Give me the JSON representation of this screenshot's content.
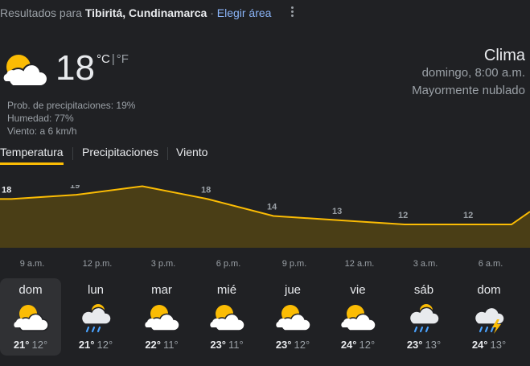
{
  "header": {
    "results_prefix": "Resultados para",
    "location": "Tibiritá, Cundinamarca",
    "separator": "·",
    "choose_area": "Elegir área"
  },
  "current": {
    "icon": "partly-cloudy-icon",
    "temperature": "18",
    "unit_c": "°C",
    "unit_sep": "|",
    "unit_f": "°F",
    "precip": "Prob. de precipitaciones: 19%",
    "humidity": "Humedad: 77%",
    "wind": "Viento: a 6 km/h",
    "title": "Clima",
    "time": "domingo, 8:00 a.m.",
    "condition": "Mayormente nublado"
  },
  "tabs": [
    {
      "label": "Temperatura",
      "active": true
    },
    {
      "label": "Precipitaciones",
      "active": false
    },
    {
      "label": "Viento",
      "active": false
    }
  ],
  "chart_data": {
    "type": "area",
    "x": [
      "9 a.m.",
      "12 p.m.",
      "3 p.m.",
      "6 p.m.",
      "9 p.m.",
      "12 a.m.",
      "3 a.m.",
      "6 a.m."
    ],
    "values": [
      18,
      19,
      21,
      18,
      14,
      13,
      12,
      12
    ],
    "ylim": [
      0,
      25
    ],
    "line_color": "#fbbc04",
    "fill_color": "#4a3e16"
  },
  "days": [
    {
      "name": "dom",
      "icon": "partly-cloudy-icon",
      "hi": "21°",
      "lo": "12°",
      "selected": true
    },
    {
      "name": "lun",
      "icon": "rain-partly-cloudy-icon",
      "hi": "21°",
      "lo": "12°",
      "selected": false
    },
    {
      "name": "mar",
      "icon": "partly-cloudy-icon",
      "hi": "22°",
      "lo": "11°",
      "selected": false
    },
    {
      "name": "mié",
      "icon": "partly-cloudy-icon",
      "hi": "23°",
      "lo": "11°",
      "selected": false
    },
    {
      "name": "jue",
      "icon": "partly-cloudy-icon",
      "hi": "23°",
      "lo": "12°",
      "selected": false
    },
    {
      "name": "vie",
      "icon": "partly-cloudy-icon",
      "hi": "24°",
      "lo": "12°",
      "selected": false
    },
    {
      "name": "sáb",
      "icon": "rain-partly-cloudy-icon",
      "hi": "23°",
      "lo": "13°",
      "selected": false
    },
    {
      "name": "dom",
      "icon": "thunderstorm-icon",
      "hi": "24°",
      "lo": "13°",
      "selected": false
    }
  ]
}
